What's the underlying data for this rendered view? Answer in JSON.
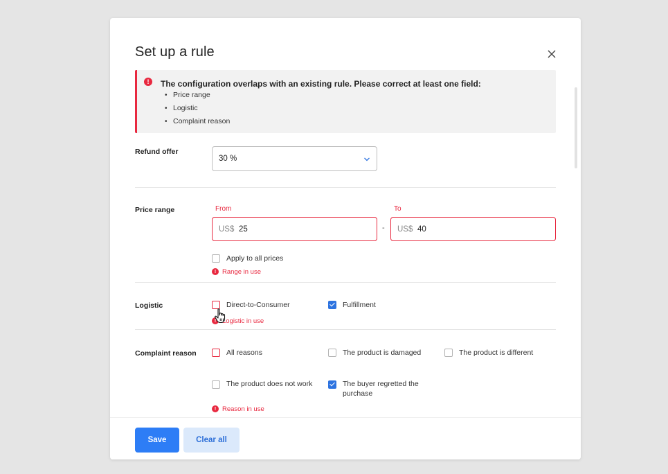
{
  "dialog": {
    "title": "Set up a rule"
  },
  "alert": {
    "message": "The configuration overlaps with an existing rule. Please correct at least one field:",
    "items": [
      "Price range",
      "Logistic",
      "Complaint reason"
    ]
  },
  "refund_offer": {
    "label": "Refund offer",
    "selected": "30 %"
  },
  "price_range": {
    "label": "Price range",
    "from_label": "From",
    "to_label": "To",
    "currency": "US$",
    "from_value": "25",
    "to_value": "40",
    "apply_all_label": "Apply to all prices",
    "apply_all_checked": false,
    "error": "Range in use"
  },
  "logistic": {
    "label": "Logistic",
    "options": [
      {
        "label": "Direct-to-Consumer",
        "checked": false
      },
      {
        "label": "Fulfillment",
        "checked": true
      }
    ],
    "error": "Logistic in use"
  },
  "complaint_reason": {
    "label": "Complaint reason",
    "options": [
      {
        "label": "All reasons",
        "checked": false
      },
      {
        "label": "The product is damaged",
        "checked": false
      },
      {
        "label": "The product is different",
        "checked": false
      },
      {
        "label": "The product does not work",
        "checked": false
      },
      {
        "label": "The buyer regretted the purchase",
        "checked": true
      }
    ],
    "error": "Reason in use"
  },
  "footer": {
    "save_label": "Save",
    "clear_label": "Clear all"
  },
  "colors": {
    "primary": "#2d7df6",
    "error": "#e8283f",
    "secondary_bg": "#dbe9fb"
  },
  "icons": {
    "close": "close-icon",
    "alert": "alert-icon",
    "chevron": "chevron-down-icon",
    "cursor": "hand-pointer-icon"
  }
}
